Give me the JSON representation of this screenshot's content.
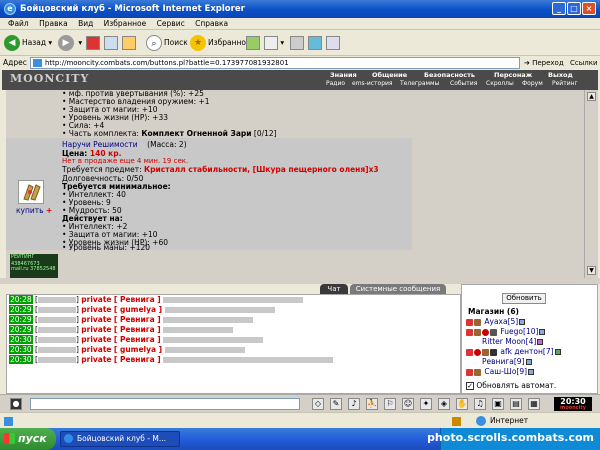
{
  "window": {
    "title": "Бойцовский клуб - Microsoft Internet Explorer",
    "buttons": [
      "_",
      "□",
      "×"
    ]
  },
  "menu": [
    "Файл",
    "Правка",
    "Вид",
    "Избранное",
    "Сервис",
    "Справка"
  ],
  "toolbar": {
    "back": "Назад",
    "search": "Поиск",
    "favorites": "Избранное"
  },
  "address": {
    "label": "Адрес",
    "url": "http://mooncity.combats.com/buttons.pl?battle=0.173977081932801",
    "go": "Переход",
    "links": "Ссылки"
  },
  "game_header": {
    "logo": "MOONCITY",
    "menu": [
      "Знания",
      "Общение",
      "Безопасность",
      "Персонаж",
      "Выход"
    ],
    "submenu": [
      "Радио",
      "ems-история",
      "Телеграммы",
      "События",
      "Скроллы",
      "Форум",
      "Рейтинг"
    ]
  },
  "item_above": {
    "lines": [
      "• мф. против увертывания (%): +25",
      "• Мастерство владения оружием: +1",
      "• Защита от магии: +10",
      "• Уровень жизни (HP): +33",
      "• Сила: +4"
    ],
    "set_prefix": "• Часть комплекта: ",
    "set_name": "Комплект Огненной Зари",
    "set_count": " [0/12]"
  },
  "item": {
    "name": "Наручи Решимости",
    "mass": "(Масса: 2)",
    "price_label": "Цена: ",
    "price_value": "140 кр.",
    "not_on_sale": "Нет в продаже еще 4 мин. 19 сек.",
    "requires_label": "Требуется предмет: ",
    "requires_value": "Кристалл стабильности, [Шкура пещерного оленя]x3",
    "durability": "Долговечность: 0/50",
    "min_req_title": "Требуется минимальное:",
    "min_req": [
      "• Интеллект: 40",
      "• Уровень: 9",
      "• Мудрость: 50"
    ],
    "acts_title": "Действует на:",
    "acts": [
      "• Интеллект: +2",
      "• Защита от магии: +10",
      "• Уровень жизни (HP): +60",
      "• Уровень маны: +120"
    ],
    "buy_label": "купить",
    "buy_plus": "+"
  },
  "counters": {
    "c1_line1": "РЕЙТИНГ 438467673",
    "c2_line1": "mail.ru",
    "c2_line2": "37852548"
  },
  "chat_tabs": [
    "Чат",
    "Системные сообщения"
  ],
  "chat": [
    {
      "time": "20:28",
      "tag": "private",
      "target": "[ Ревнига ]"
    },
    {
      "time": "20:29",
      "tag": "private",
      "target": "[ gumelya ]"
    },
    {
      "time": "20:29",
      "tag": "private",
      "target": "[ Ревнига ]"
    },
    {
      "time": "20:29",
      "tag": "private",
      "target": "[ Ревнига ]"
    },
    {
      "time": "20:30",
      "tag": "private",
      "target": "[ Ревнига ]"
    },
    {
      "time": "20:30",
      "tag": "private",
      "target": "[ gumelya ]"
    },
    {
      "time": "20:30",
      "tag": "private",
      "target": "[ Ревнига ]"
    }
  ],
  "right_panel": {
    "refresh": "Обновить",
    "room": "Магазин (6)",
    "players": [
      {
        "name": "Ауаха",
        "level": "[5]"
      },
      {
        "name": "Fuego",
        "level": "[10]"
      },
      {
        "name": "Ritter Moon",
        "level": "[4]"
      },
      {
        "name": "afk дентон",
        "level": "[7]"
      },
      {
        "name": "Ревнига",
        "level": "[9]"
      },
      {
        "name": "Саш-Шо",
        "level": "[9]"
      }
    ],
    "auto_refresh": "Обновлять автомат."
  },
  "bottom": {
    "clock": "20:30",
    "clock_sub": "mooncity"
  },
  "status": {
    "zone": "Интернет"
  },
  "taskbar": {
    "start": "пуск",
    "task": "Бойцовский клуб - М...",
    "watermark": "photo.scrolls.combats.com"
  },
  "colors": {
    "title_blue": "#0a4fc7",
    "private_red": "#d00000",
    "time_green": "#00a000",
    "nick_navy": "#000080"
  }
}
